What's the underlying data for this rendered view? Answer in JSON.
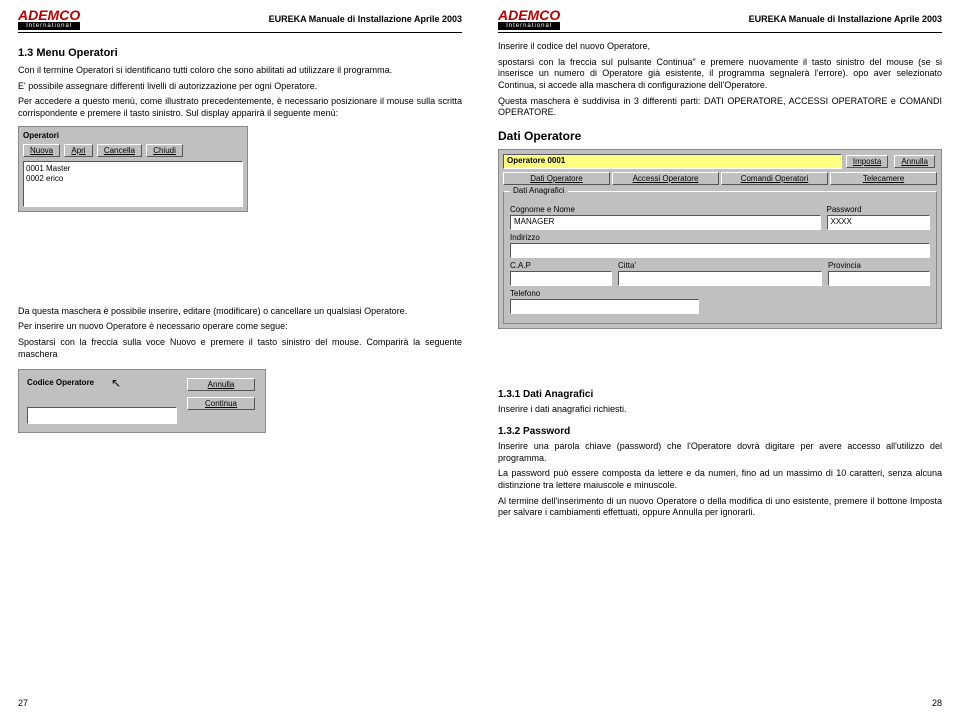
{
  "header": {
    "logo_brand": "ADEMCO",
    "logo_sub": "International",
    "title": "EUREKA Manuale di Installazione Aprile 2003"
  },
  "left": {
    "h2": "1.3 Menu Operatori",
    "p1": "Con il termine Operatori si identificano tutti coloro che sono abilitati ad utilizzare il programma.",
    "p2": "E' possibile assegnare differenti livelli di autorizzazione per ogni Operatore.",
    "p3": "Per accedere a questo menù, come illustrato precedentemente, è necessario posizionare il mouse sulla scritta corrispondente e premere il tasto sinistro. Sul display apparirà il seguente menù:",
    "operatori_box": {
      "title": "Operatori",
      "buttons": [
        "Nuova",
        "Apri",
        "Cancella",
        "Chiudi"
      ],
      "list": [
        "0001 Master",
        "0002 erico"
      ]
    },
    "p4": "Da questa maschera è possibile inserire, editare (modificare)  o cancellare un qualsiasi Operatore.",
    "p5": "Per inserire un nuovo Operatore è necessario operare come segue:",
    "p6": "Spostarsi con la freccia sulla voce Nuovo e premere il tasto sinistro del mouse. Comparirà la seguente maschera",
    "codice_box": {
      "title": "Codice Operatore",
      "btn1": "Annulla",
      "btn2": "Continua",
      "value": ""
    },
    "page_num": "27"
  },
  "right": {
    "p1": "Inserire il codice del nuovo Operatore,",
    "p2": "spostarsi con la freccia sul pulsante Continua\" e premere nuovamente il tasto sinistro del mouse (se si inserisce un numero di Operatore già esistente, il programma segnalerà l'errore). opo aver selezionato Continua, si accede alla maschera di configurazione dell'Operatore.",
    "p3": "Questa maschera è suddivisa in 3 differenti parti: DATI OPERATORE, ACCESSI OPERATORE e COMANDI OPERATORE.",
    "h3_dati": "Dati Operatore",
    "dialog": {
      "operator_label": "Operatore 0001",
      "btn_imposta": "Imposta",
      "btn_annulla": "Annulla",
      "tabs": [
        "Dati Operatore",
        "Accessi Operatore",
        "Comandi Operatori",
        "Telecamere"
      ],
      "group": "Dati Anagrafici",
      "fld_cognome": "Cognome e Nome",
      "val_cognome": "MANAGER",
      "fld_password": "Password",
      "val_password": "XXXX",
      "fld_indirizzo": "Indirizzo",
      "fld_cap": "C.A.P",
      "fld_citta": "Citta'",
      "fld_provincia": "Provincia",
      "fld_telefono": "Telefono"
    },
    "h3_1": "1.3.1 Dati Anagrafici",
    "p_1_1": "Inserire i dati anagrafici richiesti.",
    "h3_2": "1.3.2 Password",
    "p_2_1": "Inserire una parola chiave (password) che l'Operatore dovrà digitare per avere accesso all'utilizzo del programma.",
    "p_2_2": "La password può essere composta da lettere e da numeri, fino ad un massimo di 10 caratteri, senza alcuna distinzione tra lettere maiuscole e minuscole.",
    "p_2_3": "Al termine dell'inserimento di un nuovo Operatore o della modifica di uno esistente, premere il bottone Imposta per salvare i cambiamenti effettuati, oppure Annulla per ignorarli.",
    "page_num": "28"
  }
}
